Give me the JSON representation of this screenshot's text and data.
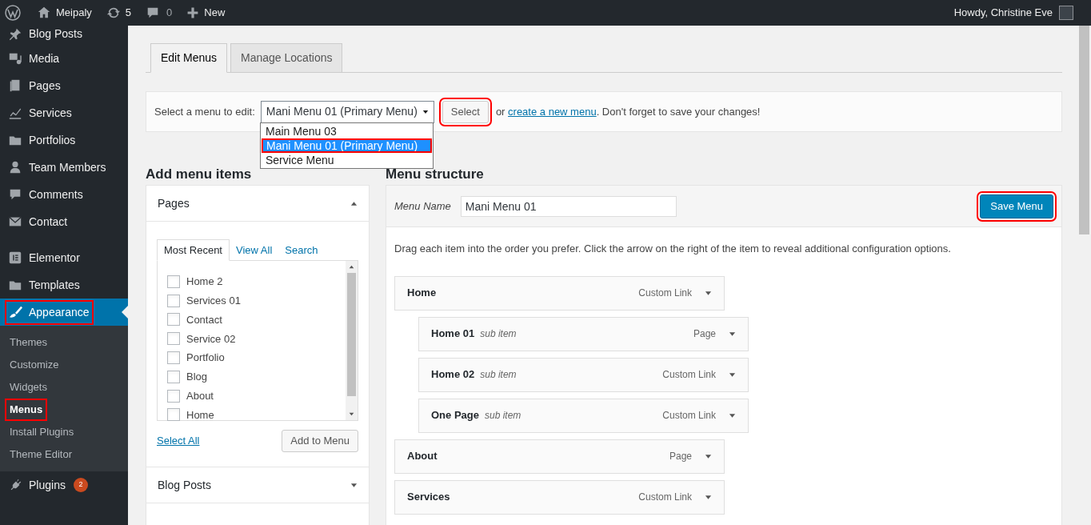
{
  "admin_bar": {
    "site": "Meipaly",
    "updates": "5",
    "comments": "0",
    "new": "New",
    "greeting": "Howdy, Christine Eve"
  },
  "sidebar": {
    "items": [
      {
        "label": "Blog Posts",
        "selected": false,
        "highlighted": false
      },
      {
        "label": "Media",
        "selected": false,
        "highlighted": false
      },
      {
        "label": "Pages",
        "selected": false,
        "highlighted": false
      },
      {
        "label": "Services",
        "selected": false,
        "highlighted": false
      },
      {
        "label": "Portfolios",
        "selected": false,
        "highlighted": false
      },
      {
        "label": "Team Members",
        "selected": false,
        "highlighted": false
      },
      {
        "label": "Comments",
        "selected": false,
        "highlighted": false
      },
      {
        "label": "Contact",
        "selected": false,
        "highlighted": false
      },
      {
        "label": "Elementor",
        "selected": false,
        "highlighted": false
      },
      {
        "label": "Templates",
        "selected": false,
        "highlighted": false
      },
      {
        "label": "Appearance",
        "selected": true,
        "highlighted": true,
        "children": [
          {
            "label": "Themes",
            "selected": false,
            "highlighted": false
          },
          {
            "label": "Customize",
            "selected": false,
            "highlighted": false
          },
          {
            "label": "Widgets",
            "selected": false,
            "highlighted": false
          },
          {
            "label": "Menus",
            "selected": true,
            "highlighted": true
          },
          {
            "label": "Install Plugins",
            "selected": false,
            "highlighted": false
          },
          {
            "label": "Theme Editor",
            "selected": false,
            "highlighted": false
          }
        ]
      },
      {
        "label": "Plugins",
        "selected": false,
        "highlighted": false,
        "badge": "2"
      }
    ]
  },
  "tabs": [
    {
      "label": "Edit Menus",
      "selected": true
    },
    {
      "label": "Manage Locations",
      "selected": false
    }
  ],
  "menu_select": {
    "label": "Select a menu to edit:",
    "value": "Mani Menu 01 (Primary Menu)",
    "button": "Select",
    "button_highlighted": true,
    "note_before": "or",
    "link": "create a new menu",
    "note_after": ". Don't forget to save your changes!",
    "options": [
      {
        "label": "Main Menu 03",
        "selected": false,
        "highlighted": false
      },
      {
        "label": "Mani Menu 01 (Primary Menu)",
        "selected": true,
        "highlighted": true
      },
      {
        "label": "Service Menu",
        "selected": false,
        "highlighted": false
      }
    ]
  },
  "add_items": {
    "title": "Add menu items",
    "panels": [
      {
        "title": "Pages",
        "expanded": true,
        "tabs": [
          {
            "label": "Most Recent",
            "selected": true
          },
          {
            "label": "View All",
            "selected": false
          },
          {
            "label": "Search",
            "selected": false
          }
        ],
        "items": [
          {
            "label": "Home 2",
            "checked": false
          },
          {
            "label": "Services 01",
            "checked": false
          },
          {
            "label": "Contact",
            "checked": false
          },
          {
            "label": "Service 02",
            "checked": false
          },
          {
            "label": "Portfolio",
            "checked": false
          },
          {
            "label": "Blog",
            "checked": false
          },
          {
            "label": "About",
            "checked": false
          },
          {
            "label": "Home",
            "checked": false
          }
        ],
        "select_all": "Select All",
        "add_button": "Add to Menu"
      },
      {
        "title": "Blog Posts",
        "expanded": false
      }
    ]
  },
  "structure": {
    "title": "Menu structure",
    "name_label": "Menu Name",
    "name_value": "Mani Menu 01",
    "save": "Save Menu",
    "save_highlighted": true,
    "instructions": "Drag each item into the order you prefer. Click the arrow on the right of the item to reveal additional configuration options.",
    "items": [
      {
        "title": "Home",
        "type": "Custom Link",
        "children": [
          {
            "title": "Home 01",
            "sub_label": "sub item",
            "type": "Page"
          },
          {
            "title": "Home 02",
            "sub_label": "sub item",
            "type": "Custom Link"
          },
          {
            "title": "One Page",
            "sub_label": "sub item",
            "type": "Custom Link"
          }
        ]
      },
      {
        "title": "About",
        "type": "Page"
      },
      {
        "title": "Services",
        "type": "Custom Link"
      }
    ]
  }
}
